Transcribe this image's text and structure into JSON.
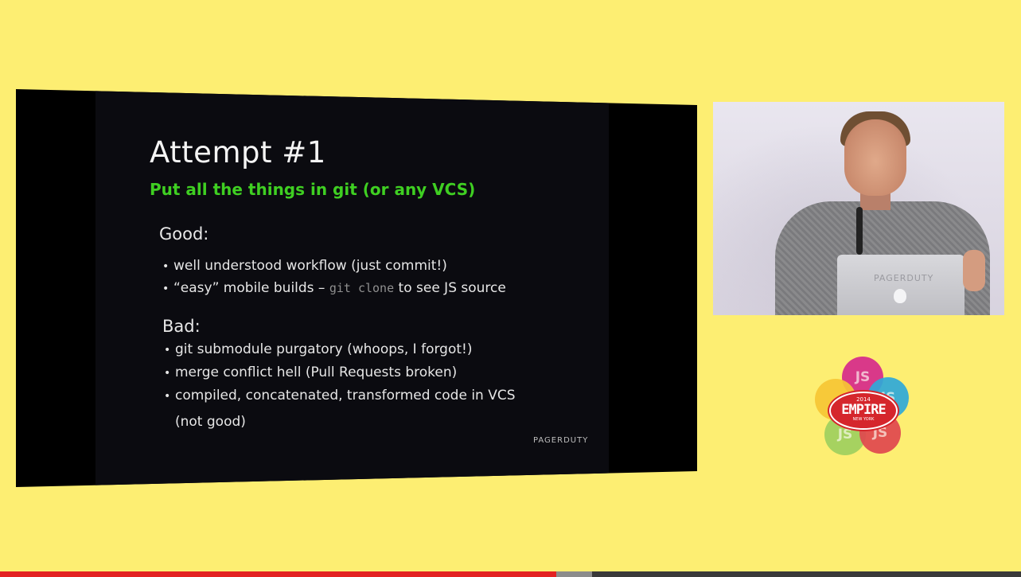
{
  "slide": {
    "title": "Attempt #1",
    "subtitle": "Put all the things in git (or any VCS)",
    "good_label": "Good:",
    "good_items": [
      {
        "bullet": "•",
        "text": "well understood workflow (just commit!)"
      },
      {
        "bullet": "•",
        "pre": "“easy” mobile builds – ",
        "code": "git clone",
        "post": " to see JS source"
      }
    ],
    "bad_label": "Bad:",
    "bad_items": [
      {
        "bullet": "•",
        "text": "git submodule purgatory (whoops, I forgot!)"
      },
      {
        "bullet": "•",
        "text": "merge conflict hell (Pull Requests broken)"
      },
      {
        "bullet": "•",
        "text": "compiled, concatenated, transformed code in VCS"
      },
      {
        "bullet": "",
        "text": "(not good)"
      }
    ],
    "corner_logo": "PAGERDUTY"
  },
  "speaker_video": {
    "laptop_label": "PAGERDUTY"
  },
  "event_logo": {
    "year": "2014",
    "word": "EMPIRE",
    "sub": "NEW YORK",
    "petal_text": [
      "JS",
      "JS",
      "JS",
      "JS"
    ]
  },
  "player": {
    "progress_fraction": 0.545,
    "buffered_fraction": 0.58
  },
  "colors": {
    "background": "#fdee72",
    "slide_accent": "#3fcf22",
    "progress": "#e32222"
  }
}
